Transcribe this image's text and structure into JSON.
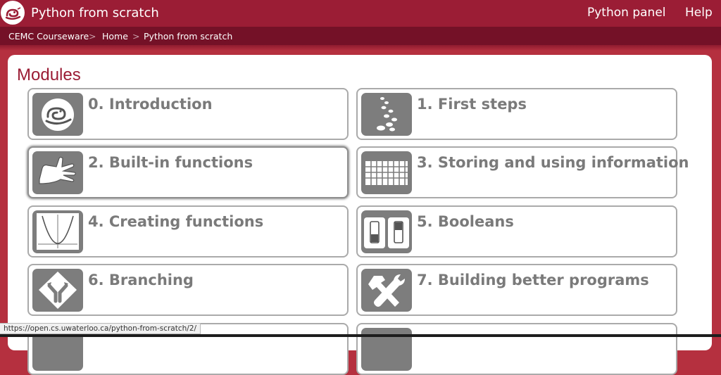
{
  "header": {
    "site_title": "Python from scratch",
    "nav": [
      "Python panel",
      "Help"
    ]
  },
  "breadcrumb": {
    "items": [
      "CEMC Courseware",
      "Home",
      "Python from scratch"
    ],
    "separator": ">"
  },
  "main": {
    "heading": "Modules",
    "modules": [
      {
        "label": "0. Introduction",
        "icon": "python-snake-icon"
      },
      {
        "label": "1. First steps",
        "icon": "footprints-icon"
      },
      {
        "label": "2. Built-in functions",
        "icon": "hand-icon"
      },
      {
        "label": "3. Storing and using information",
        "icon": "grid-table-icon"
      },
      {
        "label": "4. Creating functions",
        "icon": "parabola-graph-icon"
      },
      {
        "label": "5. Booleans",
        "icon": "on-off-switches-icon"
      },
      {
        "label": "6. Branching",
        "icon": "fork-road-sign-icon"
      },
      {
        "label": "7. Building better programs",
        "icon": "hammer-wrench-icon"
      },
      {
        "label": "",
        "icon": ""
      },
      {
        "label": "",
        "icon": ""
      }
    ]
  },
  "statusbar": {
    "url": "https://open.cs.uwaterloo.ca/python-from-scratch/2/"
  },
  "colors": {
    "header_bg": "#9b1d35",
    "breadcrumb_bg": "#741127",
    "accent": "#9b1d35",
    "card_border": "#aaaaaa",
    "icon_bg": "#7d7d7d",
    "card_text": "#7a7a7a"
  }
}
